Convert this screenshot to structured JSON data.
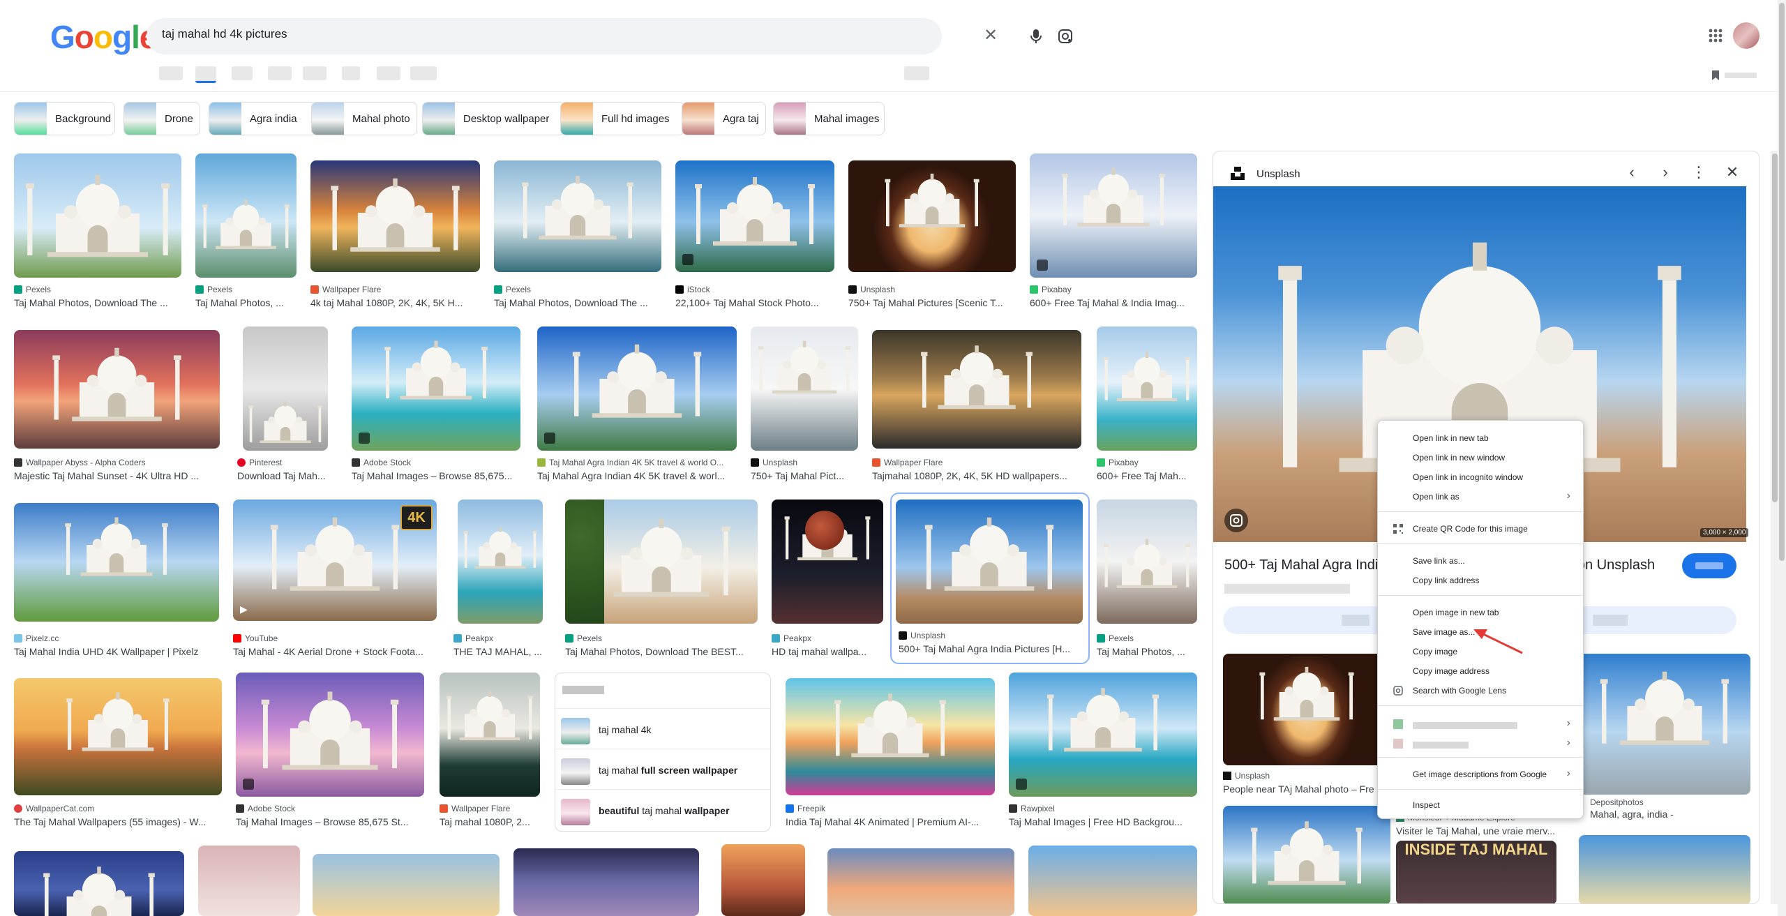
{
  "search": {
    "query": "taj mahal hd 4k pictures"
  },
  "chips": [
    {
      "label": "Background"
    },
    {
      "label": "Drone"
    },
    {
      "label": "Agra india"
    },
    {
      "label": "Mahal photo"
    },
    {
      "label": "Desktop wallpaper"
    },
    {
      "label": "Full hd images"
    },
    {
      "label": "Agra taj"
    },
    {
      "label": "Mahal images"
    }
  ],
  "results": [
    {
      "source": "Pexels",
      "title": "Taj Mahal Photos, Download The ..."
    },
    {
      "source": "Pexels",
      "title": "Taj Mahal Photos, ..."
    },
    {
      "source": "Wallpaper Flare",
      "title": "4k taj Mahal 1080P, 2K, 4K, 5K H..."
    },
    {
      "source": "Pexels",
      "title": "Taj Mahal Photos, Download The ..."
    },
    {
      "source": "iStock",
      "title": "22,100+ Taj Mahal Stock Photo..."
    },
    {
      "source": "Unsplash",
      "title": "750+ Taj Mahal Pictures [Scenic T..."
    },
    {
      "source": "Pixabay",
      "title": "600+ Free Taj Mahal & India Imag..."
    },
    {
      "source": "Wallpaper Abyss - Alpha Coders",
      "title": "Majestic Taj Mahal Sunset - 4K Ultra HD ..."
    },
    {
      "source": "Pinterest",
      "title": "Download Taj Mah..."
    },
    {
      "source": "Adobe Stock",
      "title": "Taj Mahal Images – Browse 85,675..."
    },
    {
      "source": "Taj Mahal Agra Indian 4K 5K travel & world O...",
      "title": "Taj Mahal Agra Indian 4K 5K travel & worl..."
    },
    {
      "source": "Unsplash",
      "title": "750+ Taj Mahal Pict..."
    },
    {
      "source": "Wallpaper Flare",
      "title": "Tajmahal 1080P, 2K, 4K, 5K HD wallpapers..."
    },
    {
      "source": "Pixabay",
      "title": "600+ Free Taj Mah..."
    },
    {
      "source": "Pixelz.cc",
      "title": "Taj Mahal India UHD 4K Wallpaper | Pixelz"
    },
    {
      "source": "YouTube",
      "title": "Taj Mahal - 4K Aerial Drone + Stock Foota..."
    },
    {
      "source": "Peakpx",
      "title": "THE TAJ MAHAL, ..."
    },
    {
      "source": "Pexels",
      "title": "Taj Mahal Photos, Download The BEST..."
    },
    {
      "source": "Peakpx",
      "title": "HD taj mahal wallpa..."
    },
    {
      "source": "Unsplash",
      "title": "500+ Taj Mahal Agra India Pictures [H..."
    },
    {
      "source": "Pexels",
      "title": "Taj Mahal Photos, ..."
    },
    {
      "source": "WallpaperCat.com",
      "title": "The Taj Mahal Wallpapers (55 images) - W..."
    },
    {
      "source": "Adobe Stock",
      "title": "Taj Mahal Images – Browse 85,675 St..."
    },
    {
      "source": "Wallpaper Flare",
      "title": "Taj mahal 1080P, 2..."
    },
    {
      "source": "Freepik",
      "title": "India Taj Mahal 4K Animated | Premium AI-..."
    },
    {
      "source": "Rawpixel",
      "title": "Taj Mahal Images | Free HD Backgrou..."
    }
  ],
  "youtube_badge": "4K",
  "related": {
    "items": [
      {
        "plain": "taj mahal 4k",
        "bold": "",
        "bold_first": false
      },
      {
        "plain": "taj mahal ",
        "bold": "full screen wallpaper",
        "bold_first": false
      },
      {
        "plain": " taj mahal ",
        "bold": "beautiful",
        "bold2": "wallpaper",
        "bold_first": true
      }
    ]
  },
  "panel": {
    "source": "Unsplash",
    "title": "500+ Taj Mahal Agra India P",
    "title_tail": "s on Unsplash",
    "dimensions": "3,000 × 2,000",
    "related": [
      {
        "source": "Unsplash",
        "title": "People near TAj Mahal photo – Fre"
      },
      {
        "source": "Depositphotos",
        "title": "Mahal, agra, india -"
      },
      {
        "source": "Monsieur + Madame Explore",
        "title": "Visiter le Taj Mahal, une vraie merv..."
      },
      {
        "source": "",
        "title": "INSIDE TAJ MAHAL"
      }
    ]
  },
  "context_menu": {
    "items": [
      {
        "label": "Open link in new tab"
      },
      {
        "label": "Open link in new window"
      },
      {
        "label": "Open link in incognito window"
      },
      {
        "label": "Open link as"
      },
      {
        "label": "Create QR Code for this image"
      },
      {
        "label": "Save link as..."
      },
      {
        "label": "Copy link address"
      },
      {
        "label": "Open image in new tab"
      },
      {
        "label": "Save image as..."
      },
      {
        "label": "Copy image"
      },
      {
        "label": "Copy image address"
      },
      {
        "label": "Search with Google Lens"
      },
      {
        "label": "Get image descriptions from Google"
      },
      {
        "label": "Inspect"
      }
    ]
  },
  "colors": {
    "accent": "#1a73e8",
    "annotation_arrow": "#e53935"
  }
}
